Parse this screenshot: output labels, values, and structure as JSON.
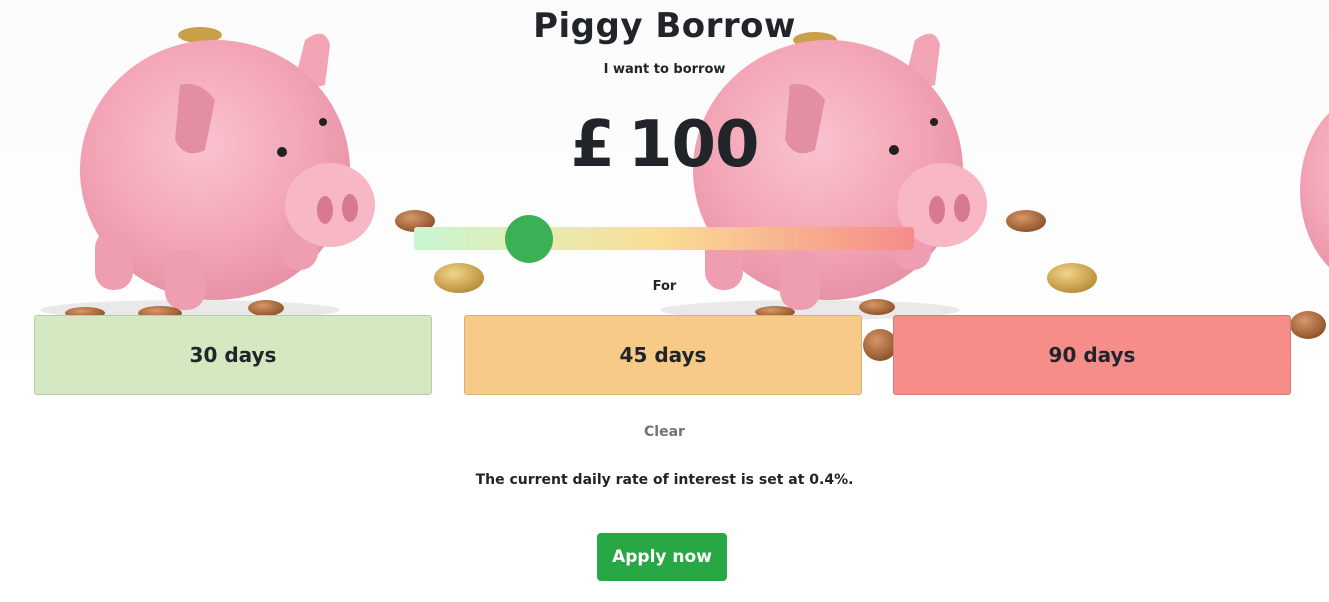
{
  "header": {
    "title": "Piggy Borrow",
    "subtitle": "I want to borrow"
  },
  "loan": {
    "currency": "£",
    "amount": "100",
    "slider_fraction": 0.23
  },
  "term": {
    "label": "For",
    "options": [
      {
        "label": "30 days",
        "color": "#d4e9c1"
      },
      {
        "label": "45 days",
        "color": "#f8ca88"
      },
      {
        "label": "90 days",
        "color": "#f68d89"
      }
    ]
  },
  "actions": {
    "clear_label": "Clear",
    "apply_label": "Apply now"
  },
  "info": {
    "rate_text": "The current daily rate of interest is set at 0.4%."
  },
  "colors": {
    "accent": "#28a745",
    "slider_thumb": "#3cb054",
    "pig_pink": "#f2a3b3"
  },
  "background": {
    "icons": [
      "piggy-bank-icon",
      "piggy-bank-icon",
      "piggy-bank-icon",
      "coin-icon"
    ]
  }
}
